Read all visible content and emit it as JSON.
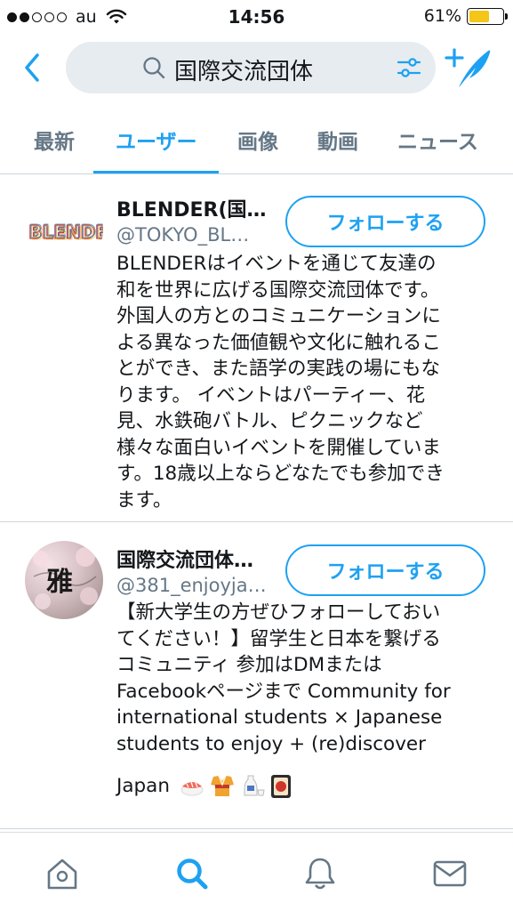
{
  "status_bar": {
    "carrier": "au",
    "time": "14:56",
    "battery_percent": "61%",
    "battery_level": 0.61
  },
  "search": {
    "query": "国際交流団体"
  },
  "tabs": [
    {
      "label": "最新",
      "active": false
    },
    {
      "label": "ユーザー",
      "active": true
    },
    {
      "label": "画像",
      "active": false
    },
    {
      "label": "動画",
      "active": false
    },
    {
      "label": "ニュース",
      "active": false
    }
  ],
  "users": [
    {
      "name": "BLENDER(国…",
      "handle": "@TOKYO_BL…",
      "follow_label": "フォローする",
      "avatar_text": "BLENDER",
      "bio_lines": [
        "BLENDERはイベントを通じて友達の",
        "和を世界に広げる国際交流団体です。",
        "外国人の方とのコミュニケーションに",
        "よる異なった価値観や文化に触れるこ",
        "とができ、また語学の実践の場にもな",
        "ります。 イベントはパーティー、花",
        "見、水鉄砲バトル、ピクニックなど",
        "様々な面白いイベントを開催していま",
        "す。18歳以上ならどなたでも参加でき",
        "ます。"
      ]
    },
    {
      "name": "国際交流団体…",
      "handle": "@381_enjoyja…",
      "follow_label": "フォローする",
      "avatar_text": "雅",
      "bio_lines": [
        "【新大学生の方ぜひフォローしておい",
        "てください！】留学生と日本を繋げる",
        "コミュニティ 参加はDMまたは",
        "Facebookページまで Community for",
        "international students × Japanese",
        "students to enjoy + (re)discover"
      ],
      "bio_last_line": "Japan",
      "bio_emojis": [
        "sushi-icon",
        "kimono-icon",
        "sake-icon",
        "hanafuda-icon"
      ]
    }
  ],
  "bottom_nav": [
    {
      "icon": "home-icon"
    },
    {
      "icon": "search-icon",
      "active": true
    },
    {
      "icon": "notifications-bell-icon"
    },
    {
      "icon": "messages-envelope-icon"
    }
  ],
  "colors": {
    "accent": "#1da1f2",
    "secondary_text": "#657786",
    "search_bg": "#e6ecf0"
  }
}
